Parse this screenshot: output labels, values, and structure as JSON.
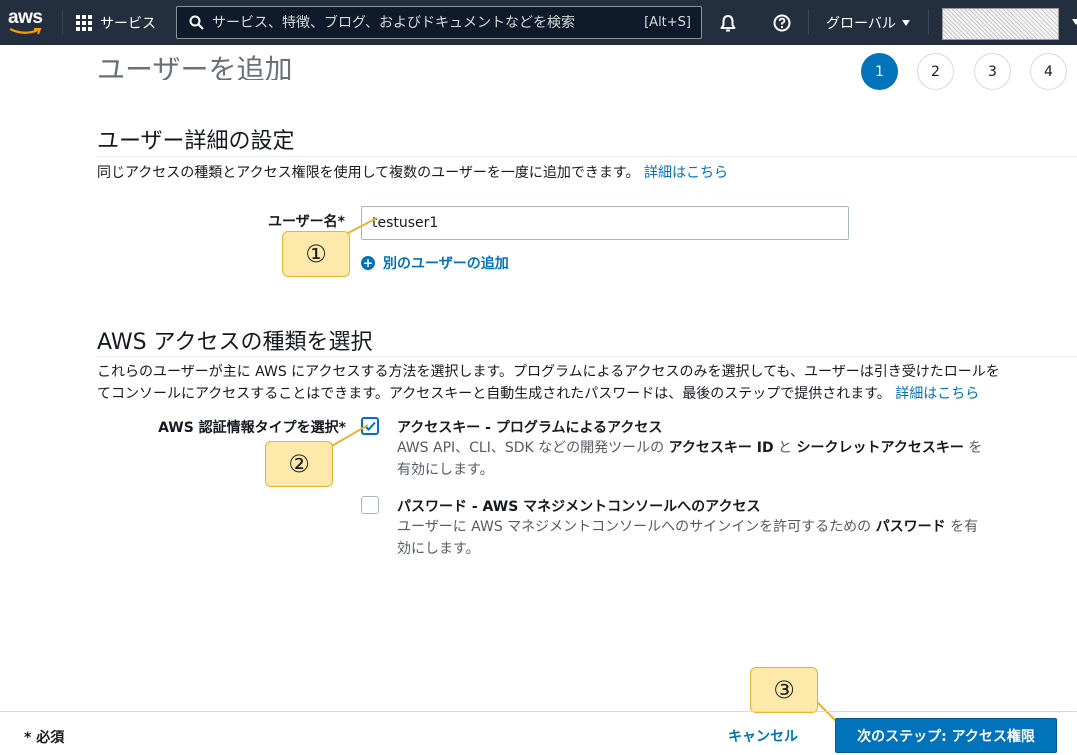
{
  "nav": {
    "logo": "aws",
    "services_label": "サービス",
    "search_placeholder": "サービス、特徴、ブログ、およびドキュメントなどを検索",
    "search_shortcut": "[Alt+S]",
    "region_label": "グローバル",
    "colors": {
      "background": "#232f3e",
      "logo_smile": "#ff9900"
    }
  },
  "page": {
    "title": "ユーザーを追加",
    "steps": [
      "1",
      "2",
      "3",
      "4"
    ],
    "current_step": 1
  },
  "user_details": {
    "title": "ユーザー詳細の設定",
    "description": "同じアクセスの種類とアクセス権限を使用して複数のユーザーを一度に追加できます。",
    "learn_more": "詳細はこちら",
    "username_label": "ユーザー名*",
    "username_value": "testuser1",
    "add_user_link": "別のユーザーの追加"
  },
  "access_type": {
    "title": "AWS アクセスの種類を選択",
    "description_line1": "これらのユーザーが主に AWS にアクセスする方法を選択します。プログラムによるアクセスのみを選択しても、ユーザーは引き受けたロールを",
    "description_line2": "てコンソールにアクセスすることはできます。アクセスキーと自動生成されたパスワードは、最後のステップで提供されます。",
    "learn_more": "詳細はこちら",
    "credential_label": "AWS 認証情報タイプを選択*",
    "options": [
      {
        "title": "アクセスキー - プログラムによるアクセス",
        "desc_pre": "AWS API、CLI、SDK などの開発ツールの ",
        "desc_b1": "アクセスキー ID",
        "desc_mid": " と ",
        "desc_b2": "シークレットアクセスキー",
        "desc_post": " を有効にします。",
        "checked": true
      },
      {
        "title": "パスワード - AWS マネジメントコンソールへのアクセス",
        "desc_pre": "ユーザーに AWS マネジメントコンソールへのサインインを許可するための ",
        "desc_b1": "パスワード",
        "desc_post": " を有効にします。",
        "checked": false
      }
    ]
  },
  "callouts": [
    "①",
    "②",
    "③"
  ],
  "footer": {
    "required_note": "* 必須",
    "cancel_label": "キャンセル",
    "next_label": "次のステップ: アクセス権限",
    "primary_color": "#0073bb"
  }
}
